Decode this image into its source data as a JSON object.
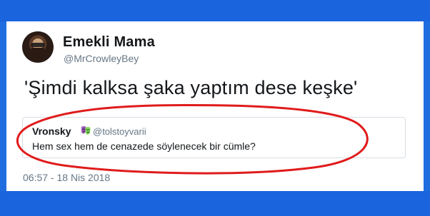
{
  "tweet": {
    "author_name": "Emekli Mama",
    "author_handle": "@MrCrowleyBey",
    "text": "'Şimdi kalksa şaka yaptım dese keşke'",
    "timestamp": "06:57 - 18 Nis 2018"
  },
  "quoted": {
    "author_name": "Vronsky",
    "emoji": "theater-masks-icon",
    "author_handle": "@tolstoyvarii",
    "text": "Hem sex hem de cenazede söylenecek bir cümle?"
  },
  "colors": {
    "background_blue": "#1f6ee0",
    "annotation_red": "#e01b1b",
    "secondary_text": "#657786"
  }
}
